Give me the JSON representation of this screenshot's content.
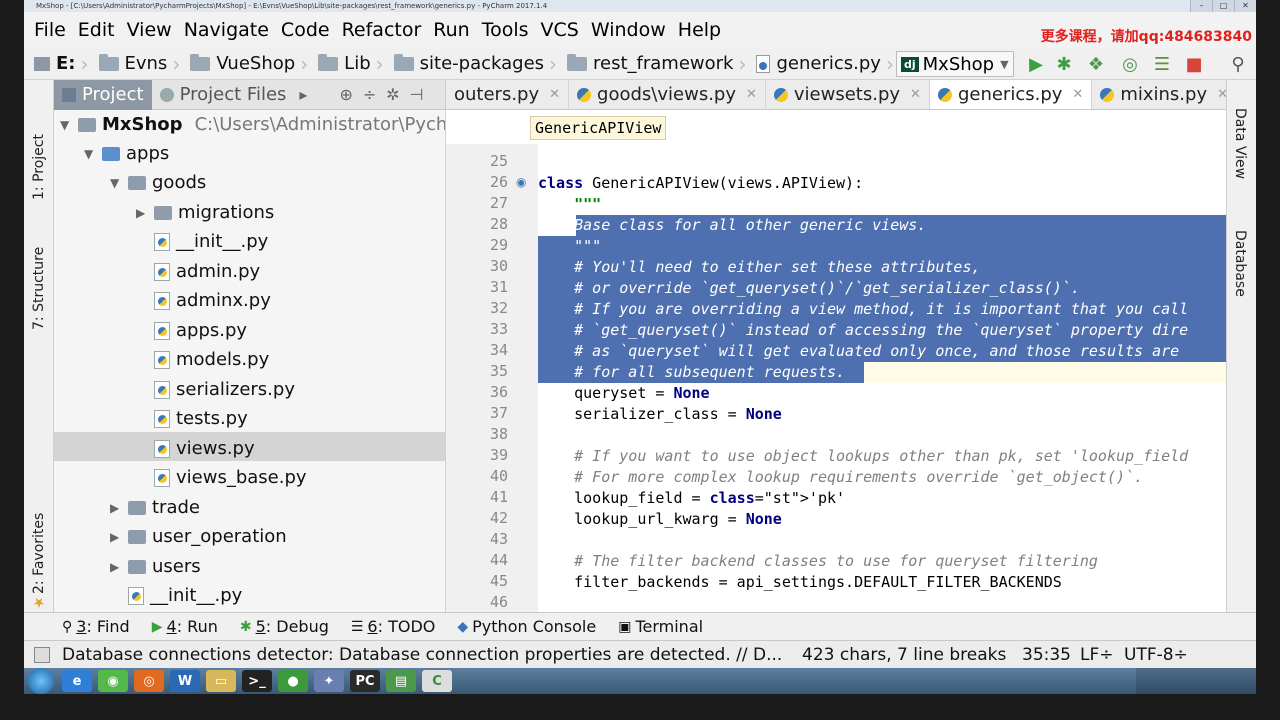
{
  "window": {
    "title": "MxShop - [C:\\Users\\Administrator\\PycharmProjects\\MxShop] - E:\\Evns\\VueShop\\Lib\\site-packages\\rest_framework\\generics.py - PyCharm 2017.1.4"
  },
  "menubar": {
    "items": [
      "File",
      "Edit",
      "View",
      "Navigate",
      "Code",
      "Refactor",
      "Run",
      "Tools",
      "VCS",
      "Window",
      "Help"
    ],
    "promo": "更多课程，请加qq:484683840"
  },
  "navbar": {
    "crumbs": [
      "E:",
      "Evns",
      "VueShop",
      "Lib",
      "site-packages",
      "rest_framework",
      "generics.py"
    ],
    "run_config": "MxShop",
    "run_config_badge": "dj"
  },
  "left_strip": {
    "project": "1: Project",
    "structure": "7: Structure",
    "favorites": "2: Favorites"
  },
  "right_strip": {
    "data_view": "Data View",
    "database": "Database"
  },
  "project_panel": {
    "tabs": [
      "Project",
      "Project Files"
    ],
    "tree": [
      {
        "label": "MxShop",
        "path": "C:\\Users\\Administrator\\Pycha",
        "bold": true
      },
      {
        "label": "apps"
      },
      {
        "label": "goods"
      },
      {
        "label": "migrations"
      },
      {
        "label": "__init__.py"
      },
      {
        "label": "admin.py"
      },
      {
        "label": "adminx.py"
      },
      {
        "label": "apps.py"
      },
      {
        "label": "models.py"
      },
      {
        "label": "serializers.py"
      },
      {
        "label": "tests.py"
      },
      {
        "label": "views.py"
      },
      {
        "label": "views_base.py"
      },
      {
        "label": "trade"
      },
      {
        "label": "user_operation"
      },
      {
        "label": "users"
      },
      {
        "label": "__init__.py"
      }
    ]
  },
  "editor": {
    "tabs": [
      "outers.py",
      "goods\\views.py",
      "viewsets.py",
      "generics.py",
      "mixins.py"
    ],
    "active_tab": "generics.py",
    "breadcrumb_hint": "GenericAPIView",
    "line_numbers": [
      "25",
      "26",
      "27",
      "28",
      "29",
      "30",
      "31",
      "32",
      "33",
      "34",
      "35",
      "36",
      "37",
      "38",
      "39",
      "40",
      "41",
      "42",
      "43",
      "44",
      "45",
      "46"
    ],
    "lines": [
      "",
      "class GenericAPIView(views.APIView):",
      "    \"\"\"",
      "    Base class for all other generic views.",
      "    \"\"\"",
      "    # You'll need to either set these attributes,",
      "    # or override `get_queryset()`/`get_serializer_class()`.",
      "    # If you are overriding a view method, it is important that you call",
      "    # `get_queryset()` instead of accessing the `queryset` property dire",
      "    # as `queryset` will get evaluated only once, and those results are",
      "    # for all subsequent requests.",
      "    queryset = None",
      "    serializer_class = None",
      "",
      "    # If you want to use object lookups other than pk, set 'lookup_field",
      "    # For more complex lookup requirements override `get_object()`.",
      "    lookup_field = 'pk'",
      "    lookup_url_kwarg = None",
      "",
      "    # The filter backend classes to use for queryset filtering",
      "    filter_backends = api_settings.DEFAULT_FILTER_BACKENDS",
      ""
    ]
  },
  "tool_windows": [
    {
      "key": "3",
      "label": ": Find"
    },
    {
      "key": "4",
      "label": ": Run"
    },
    {
      "key": "5",
      "label": ": Debug"
    },
    {
      "key": "6",
      "label": ": TODO"
    },
    {
      "key": "",
      "label": "Python Console"
    },
    {
      "key": "",
      "label": "Terminal"
    }
  ],
  "statusbar": {
    "message": "Database connections detector: Database connection properties are detected. // D...",
    "selection": "423 chars, 7 line breaks",
    "position": "35:35",
    "line_sep": "LF÷",
    "encoding": "UTF-8÷"
  }
}
